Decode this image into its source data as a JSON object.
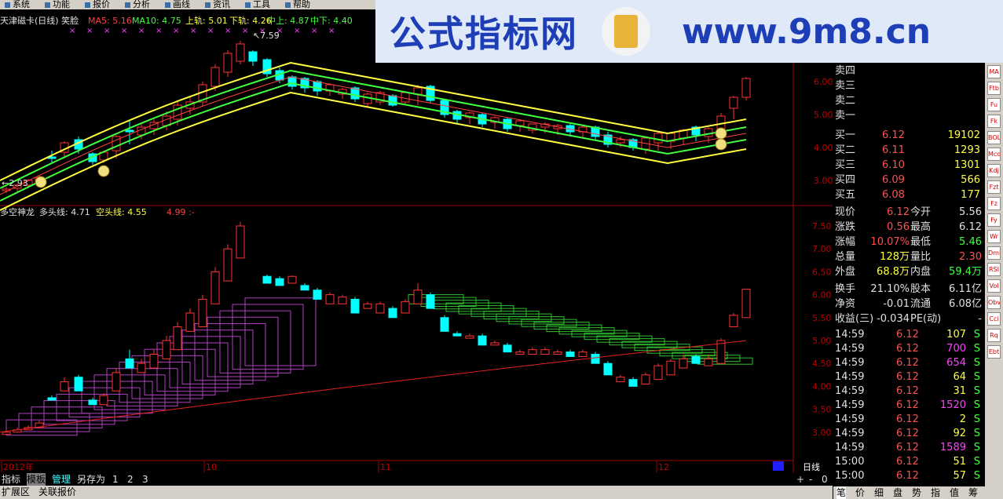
{
  "menu": [
    "系统",
    "功能",
    "报价",
    "分析",
    "画线",
    "资讯",
    "工具",
    "帮助"
  ],
  "banner": {
    "cn_text": "公式指标网",
    "url_text": "www.9m8.cn"
  },
  "main_header": {
    "title": "天津磁卡(日线) 笑脸",
    "ma5": "MA5: 5.16",
    "ma10": "MA10: 4.75",
    "upper": "上轨: 5.01",
    "lower": "下轨: 4.26",
    "mid_upper": "中上: 4.87",
    "mid_lower": "中下: 4.40"
  },
  "sub_header": {
    "title": "多空神龙",
    "bull": "多头线: 4.71",
    "bear": "空头线: 4.55",
    "extra": "4.99 :-"
  },
  "annotations": {
    "high": "7.59",
    "low": "2.93"
  },
  "main_axis": [
    "6.00",
    "5.00",
    "4.00",
    "3.00"
  ],
  "sub_axis": [
    "7.50",
    "7.00",
    "6.50",
    "6.00",
    "5.50",
    "5.00",
    "4.50",
    "4.00",
    "3.50",
    "3.00"
  ],
  "x_axis": [
    "2012年",
    "10",
    "11",
    "12"
  ],
  "period_label": "日线",
  "bottom_tabs": [
    "指标",
    "模板",
    "管理",
    "另存为",
    "1",
    "2",
    "3"
  ],
  "bottom_tabs2": [
    "扩展区",
    "关联报价"
  ],
  "zoom": [
    "+",
    "-",
    "0"
  ],
  "sell": [
    {
      "l": "卖四"
    },
    {
      "l": "卖三"
    },
    {
      "l": "卖二"
    },
    {
      "l": "卖一"
    }
  ],
  "buy": [
    {
      "l": "买一",
      "p": "6.12",
      "v": "19102"
    },
    {
      "l": "买二",
      "p": "6.11",
      "v": "1293"
    },
    {
      "l": "买三",
      "p": "6.10",
      "v": "1301"
    },
    {
      "l": "买四",
      "p": "6.09",
      "v": "566"
    },
    {
      "l": "买五",
      "p": "6.08",
      "v": "177"
    }
  ],
  "quote": [
    [
      "现价",
      "6.12",
      "今开",
      "5.56"
    ],
    [
      "涨跌",
      "0.56",
      "最高",
      "6.12"
    ],
    [
      "涨幅",
      "10.07%",
      "最低",
      "5.46"
    ],
    [
      "总量",
      "128万",
      "量比",
      "2.30"
    ],
    [
      "外盘",
      "68.8万",
      "内盘",
      "59.4万"
    ],
    [
      "换手",
      "21.10%",
      "股本",
      "6.11亿"
    ],
    [
      "净资",
      "-0.01",
      "流通",
      "6.08亿"
    ],
    [
      "收益(三)",
      "-0.034",
      "PE(动)",
      "-"
    ]
  ],
  "ticks": [
    [
      "14:59",
      "6.12",
      "107",
      "S"
    ],
    [
      "14:59",
      "6.12",
      "700",
      "S"
    ],
    [
      "14:59",
      "6.12",
      "654",
      "S"
    ],
    [
      "14:59",
      "6.12",
      "64",
      "S"
    ],
    [
      "14:59",
      "6.12",
      "31",
      "S"
    ],
    [
      "14:59",
      "6.12",
      "1520",
      "S"
    ],
    [
      "14:59",
      "6.12",
      "2",
      "S"
    ],
    [
      "14:59",
      "6.12",
      "92",
      "S"
    ],
    [
      "14:59",
      "6.12",
      "1589",
      "S"
    ],
    [
      "15:00",
      "6.12",
      "51",
      "S"
    ],
    [
      "15:00",
      "6.12",
      "57",
      "S"
    ]
  ],
  "side_tabs": [
    "笔",
    "价",
    "细",
    "盘",
    "势",
    "指",
    "值",
    "筹"
  ],
  "side_icons": [
    "MA",
    "Ftb",
    "Fu",
    "Fk",
    "BOL",
    "Mcd",
    "Kdj",
    "Fzt",
    "Fz",
    "Fy",
    "Wr",
    "Dmi",
    "RSI",
    "Vol",
    "Obv",
    "Cci",
    "Rq",
    "Ebt"
  ],
  "colors": {
    "up": "#ff3333",
    "down": "#00ffff",
    "yellow": "#ffff00",
    "green": "#00e000",
    "purple": "#c040c0"
  }
}
